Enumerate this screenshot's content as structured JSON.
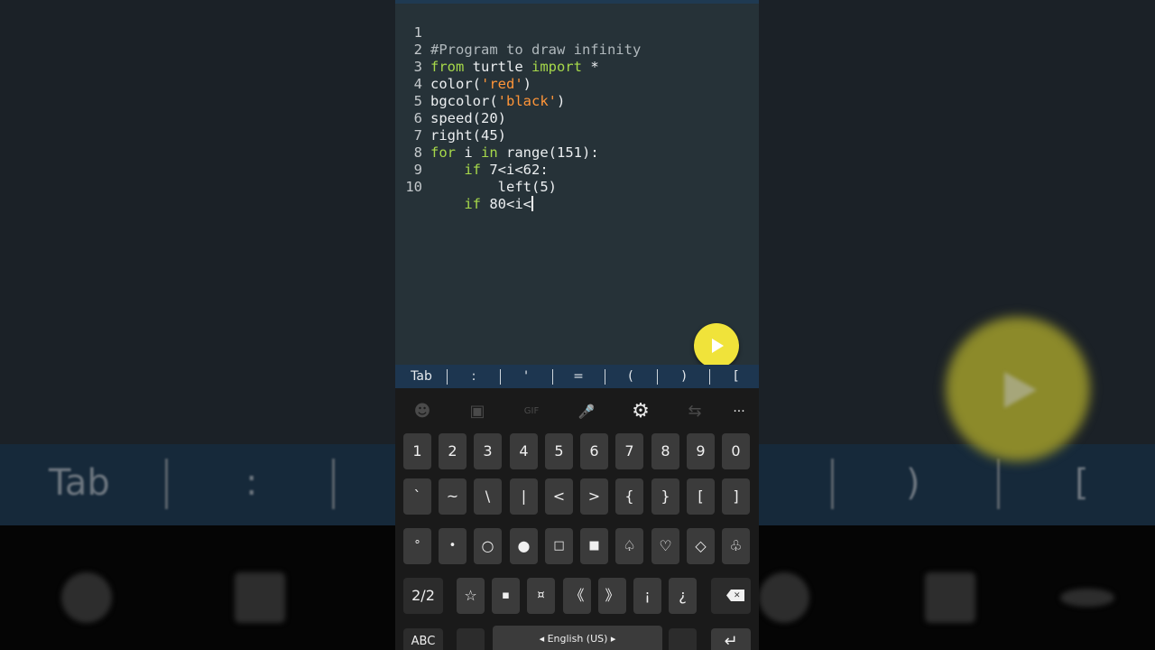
{
  "editor": {
    "lines": [
      {
        "num": "1",
        "text": "#Program to draw infinity"
      },
      {
        "num": "2",
        "kw1": "from",
        "mid": " turtle ",
        "kw2": "import",
        "rest": " *"
      },
      {
        "num": "3",
        "pre": "color(",
        "str": "'red'",
        "post": ")"
      },
      {
        "num": "4",
        "pre": "bgcolor(",
        "str": "'black'",
        "post": ")"
      },
      {
        "num": "5",
        "text": "speed(20)"
      },
      {
        "num": "6",
        "text": "right(45)"
      },
      {
        "num": "7",
        "kw1": "for",
        "mid": " i ",
        "kw2": "in",
        "rest": " range(151):"
      },
      {
        "num": "8",
        "indent": "    ",
        "kw": "if",
        "rest": " 7<i<62:"
      },
      {
        "num": "9",
        "text": "        left(5)"
      },
      {
        "num": "10",
        "indent": "    ",
        "kw": "if",
        "rest": " 80<i<"
      }
    ]
  },
  "symbar": [
    "Tab",
    ":",
    "'",
    "=",
    "(",
    ")",
    "["
  ],
  "keyboard": {
    "toolbar_icons": [
      "emoji-icon",
      "sticker-icon",
      "gif-icon",
      "mic-icon",
      "gear-icon",
      "translate-icon",
      "more-icon"
    ],
    "toolbar_glyphs": [
      "☻",
      "▣",
      "GIF",
      "🎤",
      "⚙",
      "⇆",
      "···"
    ],
    "row1": [
      "1",
      "2",
      "3",
      "4",
      "5",
      "6",
      "7",
      "8",
      "9",
      "0"
    ],
    "row2": [
      "`",
      "~",
      "\\",
      "|",
      "<",
      ">",
      "{",
      "}",
      "[",
      "]"
    ],
    "row3": [
      "°",
      "•",
      "○",
      "●",
      "□",
      "■",
      "♤",
      "♡",
      "◇",
      "♧"
    ],
    "row4": [
      "☆",
      "▪",
      "¤",
      "《",
      "》",
      "¡",
      "¿"
    ],
    "page_label": "2/2",
    "abc_label": "ABC",
    "space_label": "◂  English (US)  ▸"
  },
  "background": {
    "tab_label": "Tab",
    "colon": ":",
    "paren": ")",
    "bracket": "["
  },
  "colors": {
    "editor_bg": "#263238",
    "keyword": "#a6d84a",
    "string": "#ff9538",
    "run_button": "#f0e33a",
    "symbar_bg": "#1d3650"
  }
}
